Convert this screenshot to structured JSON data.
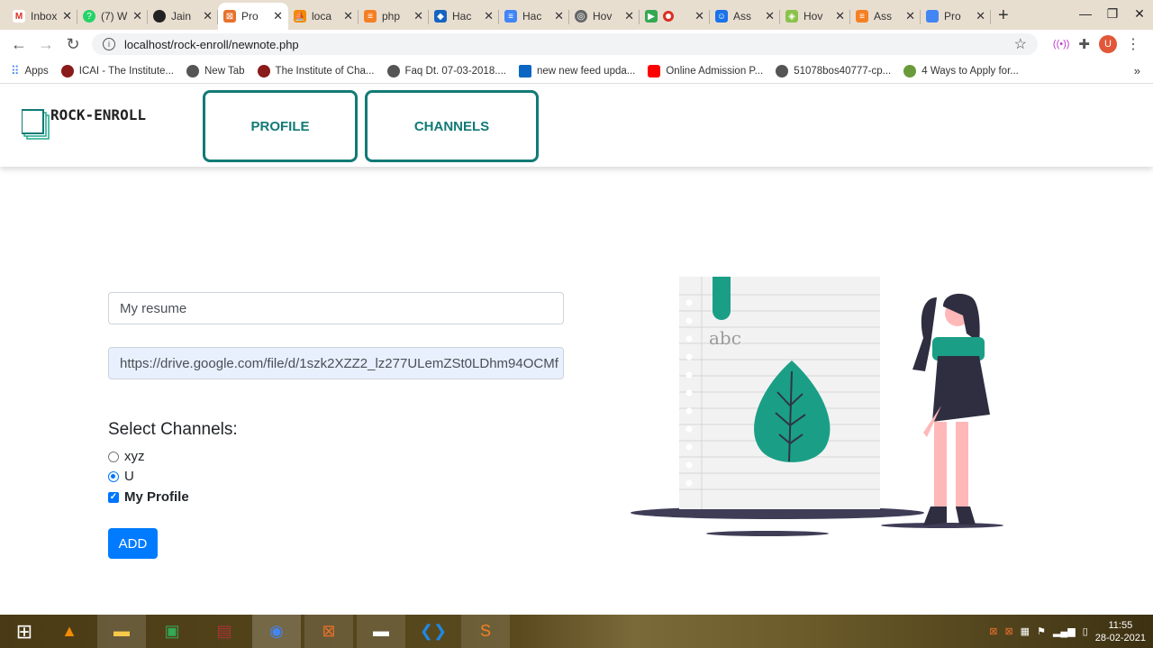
{
  "browser": {
    "tabs": [
      {
        "label": "Inbox",
        "color": "#d93025"
      },
      {
        "label": "(7) W",
        "color": "#25d366"
      },
      {
        "label": "Jain",
        "color": "#222222"
      },
      {
        "label": "Pro",
        "color": "#e8702a"
      },
      {
        "label": "loca",
        "color": "#f28b00"
      },
      {
        "label": "php",
        "color": "#f48024"
      },
      {
        "label": "Hac",
        "color": "#1565c0"
      },
      {
        "label": "Hac",
        "color": "#4285f4"
      },
      {
        "label": "Hov",
        "color": "#666666"
      },
      {
        "label": "",
        "color": "#34a853"
      },
      {
        "label": "Ass",
        "color": "#1a73e8"
      },
      {
        "label": "Hov",
        "color": "#8bc34a"
      },
      {
        "label": "Ass",
        "color": "#f48024"
      },
      {
        "label": "Pro",
        "color": "#4285f4"
      }
    ],
    "url": "localhost/rock-enroll/newnote.php",
    "avatar_letter": "U",
    "bookmarks": [
      {
        "label": "Apps",
        "color": "#4285f4"
      },
      {
        "label": "ICAI - The Institute...",
        "color": "#8b1a1a"
      },
      {
        "label": "New Tab",
        "color": "#555555"
      },
      {
        "label": "The Institute of Cha...",
        "color": "#8b1a1a"
      },
      {
        "label": "Faq Dt. 07-03-2018....",
        "color": "#555555"
      },
      {
        "label": "new new feed upda...",
        "color": "#0a66c2"
      },
      {
        "label": "Online Admission P...",
        "color": "#ff0000"
      },
      {
        "label": "51078bos40777-cp...",
        "color": "#555555"
      },
      {
        "label": "4 Ways to Apply for...",
        "color": "#6a9a3a"
      }
    ]
  },
  "site": {
    "logo_text": "ROCK-ENROLL",
    "nav": {
      "profile": "PROFILE",
      "channels": "CHANNELS"
    },
    "accent": "#127a76"
  },
  "form": {
    "title_value": "My resume",
    "link_value": "https://drive.google.com/file/d/1szk2XZZ2_lz277ULemZSt0LDhm94OCMf",
    "channels_heading": "Select Channels:",
    "options": [
      {
        "label": "xyz",
        "type": "radio",
        "checked": false
      },
      {
        "label": "U",
        "type": "radio",
        "checked": true
      },
      {
        "label": "My Profile",
        "type": "checkbox",
        "checked": true
      }
    ],
    "add_label": "ADD"
  },
  "illustration": {
    "note_text": "abc"
  },
  "taskbar": {
    "time": "11:55",
    "date": "28-02-2021"
  }
}
